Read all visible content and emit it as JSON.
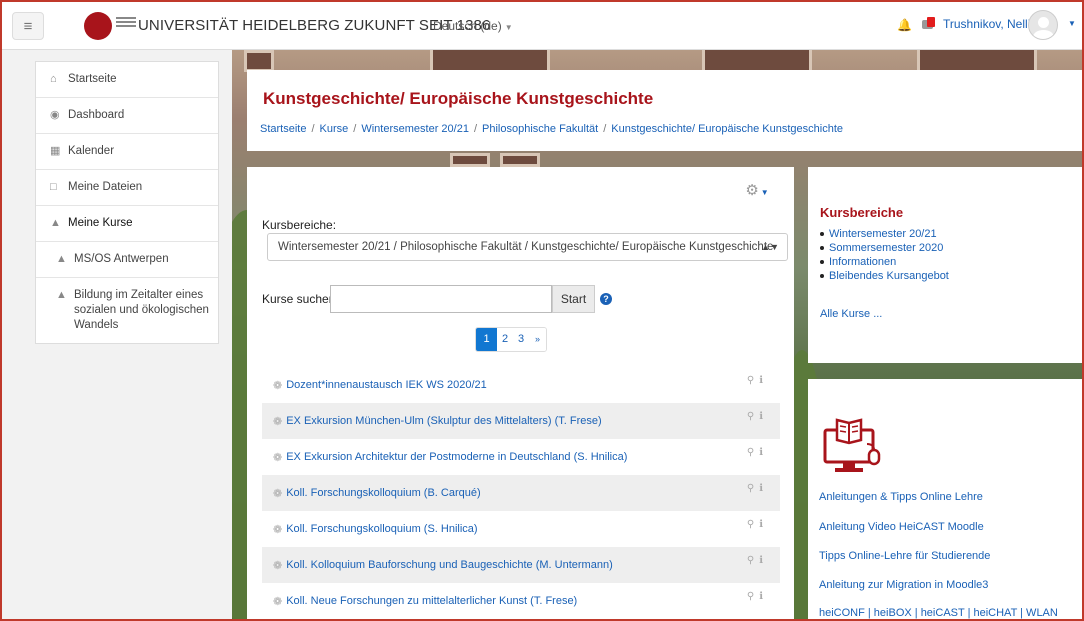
{
  "navbar": {
    "menu_icon": "hamburger-icon",
    "site_name": "UNIVERSITÄT HEIDELBERG ZUKUNFT SEIT 1386",
    "language": "Deutsch (de)",
    "username": "Trushnikov, Nelli"
  },
  "nav_drawer": {
    "items": [
      {
        "icon": "home-icon",
        "label": "Startseite"
      },
      {
        "icon": "dashboard-icon",
        "label": "Dashboard"
      },
      {
        "icon": "calendar-icon",
        "label": "Kalender"
      },
      {
        "icon": "file-icon",
        "label": "Meine Dateien"
      },
      {
        "icon": "graduation-cap-icon",
        "label": "Meine Kurse"
      },
      {
        "icon": "graduation-cap-icon",
        "label": "MS/OS Antwerpen"
      },
      {
        "icon": "graduation-cap-icon",
        "label": "Bildung im Zeitalter eines sozialen und ökologischen Wandels"
      }
    ]
  },
  "header": {
    "title": "Kunstgeschichte/ Europäische Kunstgeschichte",
    "breadcrumb": [
      "Startseite",
      "Kurse",
      "Wintersemester 20/21",
      "Philosophische Fakultät",
      "Kunstgeschichte/ Europäische Kunstgeschichte"
    ]
  },
  "main": {
    "kursbereiche_label": "Kursbereiche:",
    "kursbereiche_selected": "Wintersemester 20/21 / Philosophische Fakultät / Kunstgeschichte/ Europäische Kunstgeschichte",
    "search_label": "Kurse suchen",
    "search_value": "",
    "start_button": "Start",
    "help_glyph": "?",
    "pagination": [
      "1",
      "2",
      "3",
      "»"
    ],
    "current_page": 1,
    "courses": [
      "Dozent*innenaustausch IEK WS 2020/21",
      "EX Exkursion München-Ulm (Skulptur des Mittelalters) (T. Frese)",
      "EX Exkursion Architektur der Postmoderne in Deutschland (S. Hnilica)",
      "Koll. Forschungskolloquium (B. Carqué)",
      "Koll. Forschungskolloquium (S. Hnilica)",
      "Koll. Kolloquium Bauforschung und Baugeschichte (M. Untermann)",
      "Koll. Neue Forschungen zu mittelalterlicher Kunst (T. Frese)"
    ]
  },
  "kursbereiche_block": {
    "title": "Kursbereiche",
    "items": [
      "Wintersemester 20/21",
      "Sommersemester 2020",
      "Informationen",
      "Bleibendes Kursangebot"
    ],
    "all_link": "Alle Kurse ..."
  },
  "links_block": {
    "icon": "online-learning-icon",
    "links": [
      "Anleitungen & Tipps Online Lehre",
      "Anleitung Video HeiCAST Moodle",
      "Tipps Online-Lehre für Studierende",
      "Anleitung zur Migration in Moodle3",
      "heiCONF | heiBOX | heiCAST | heiCHAT | WLAN"
    ]
  },
  "colors": {
    "brand_red": "#a8141b",
    "link_blue": "#1a61b6",
    "active_page": "#1177d1"
  }
}
